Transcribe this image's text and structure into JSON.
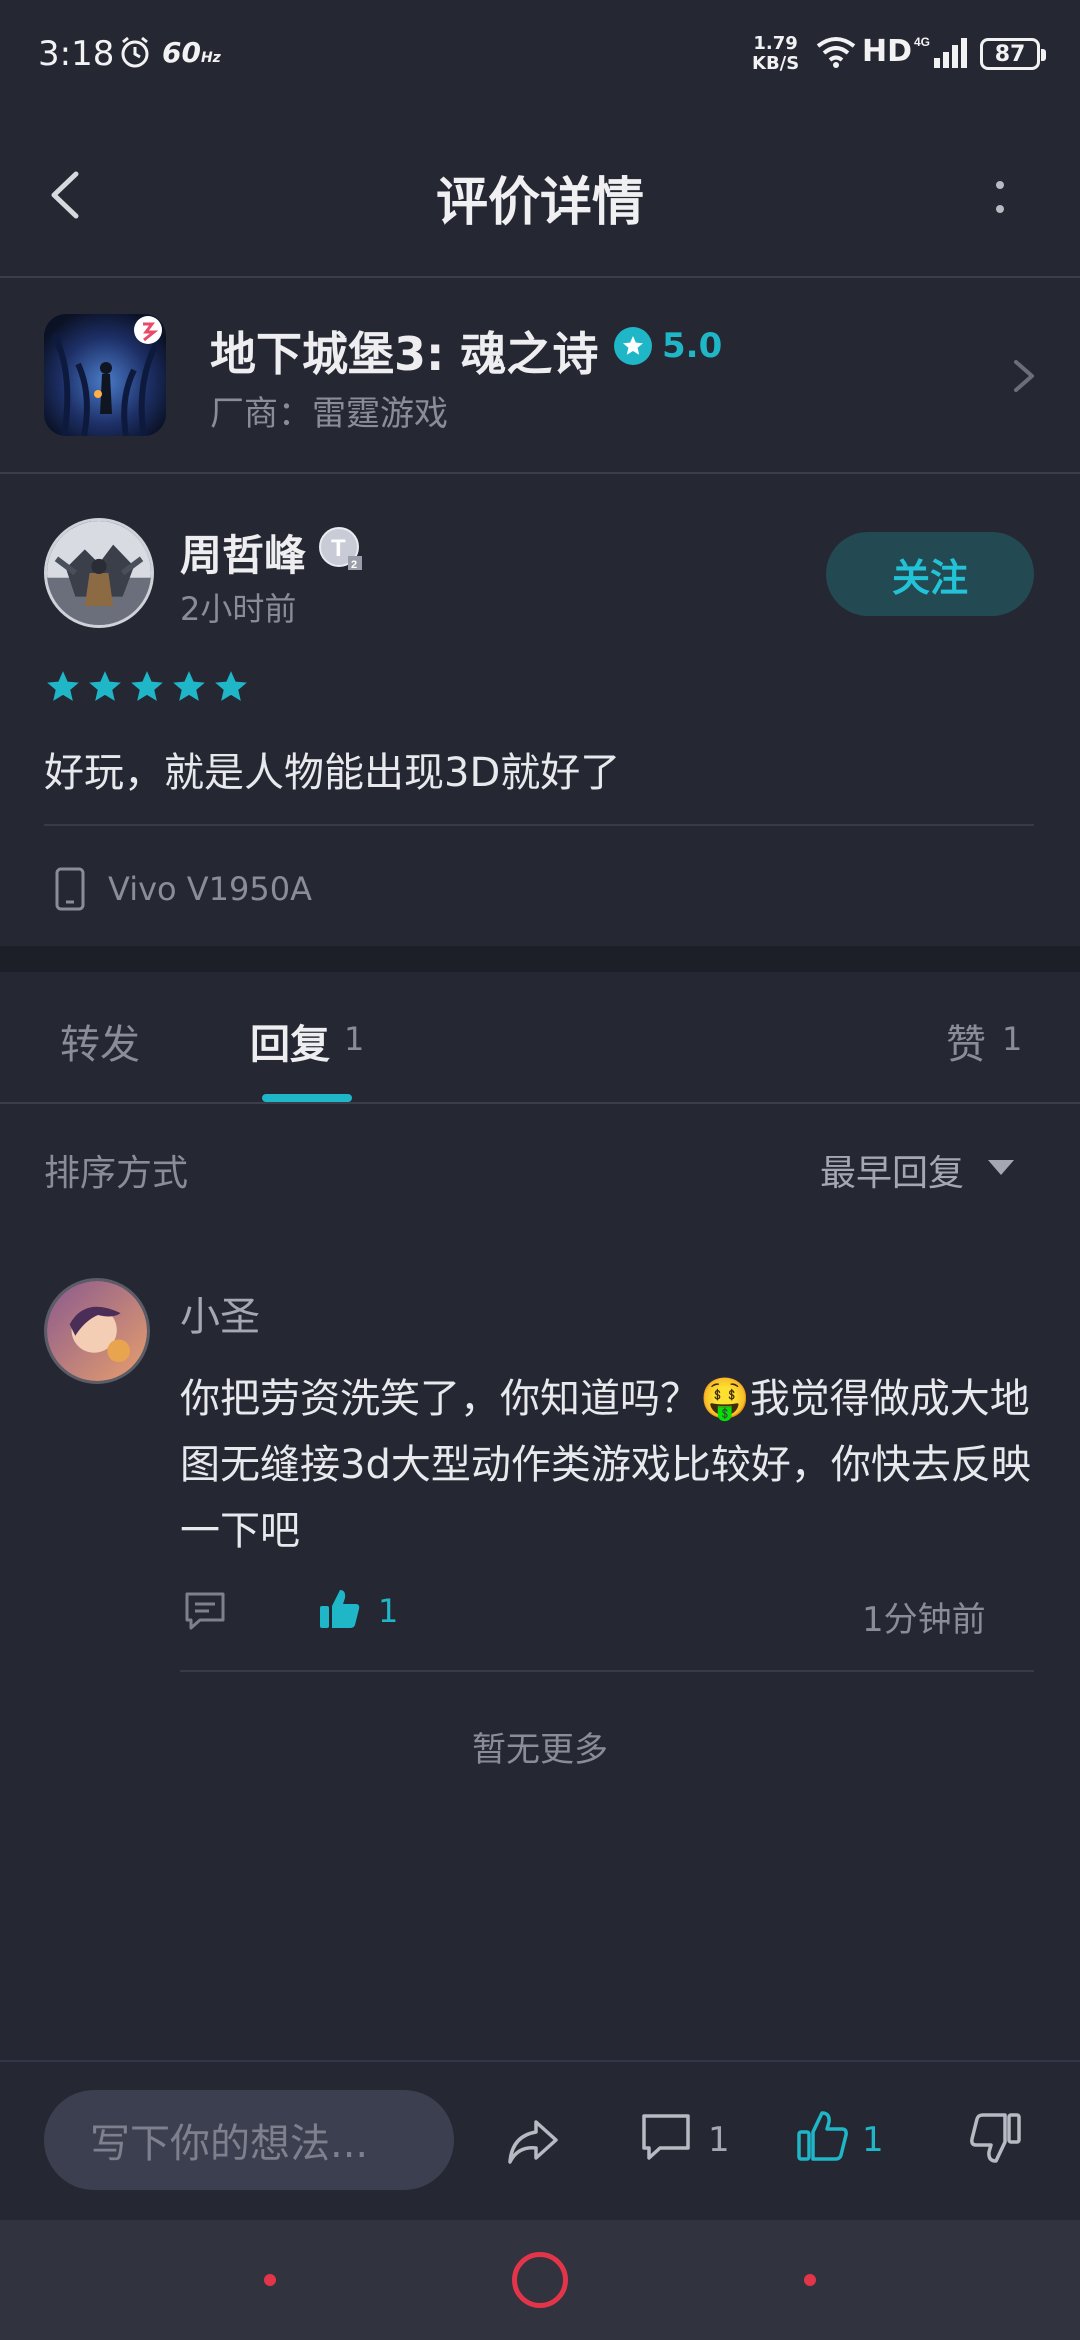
{
  "status_bar": {
    "time": "3:18",
    "refresh_rate": "60",
    "refresh_unit": "Hz",
    "net_speed_value": "1.79",
    "net_speed_unit": "KB/S",
    "signal_label": "HD",
    "battery": "87"
  },
  "header": {
    "title": "评价详情"
  },
  "game": {
    "name": "地下城堡3: 魂之诗",
    "rating": "5.0",
    "vendor": "厂商：雷霆游戏"
  },
  "review": {
    "user_name": "周哲峰",
    "time": "2小时前",
    "follow_label": "关注",
    "stars": 5,
    "text": "好玩，就是人物能出现3D就好了",
    "device": "Vivo V1950A"
  },
  "tabs": {
    "forward": "转发",
    "reply": "回复",
    "reply_count": "1",
    "likes": "赞",
    "likes_count": "1"
  },
  "sort": {
    "label": "排序方式",
    "value": "最早回复"
  },
  "reply": {
    "user": "小圣",
    "text": "你把劳资洗笑了，你知道吗？🤑我觉得做成大地图无缝接3d大型动作类游戏比较好，你快去反映一下吧",
    "like_count": "1",
    "time": "1分钟前"
  },
  "no_more_text": "暂无更多",
  "bottom_bar": {
    "input_placeholder": "写下你的想法...",
    "comments_count": "1",
    "likes_count": "1"
  },
  "colors": {
    "accent": "#1fb6c8",
    "background": "#252733",
    "nav_accent": "#e3354a"
  }
}
